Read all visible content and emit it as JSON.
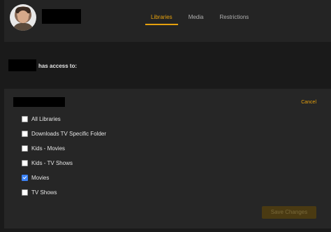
{
  "header": {
    "tabs": [
      {
        "label": "Libraries",
        "active": true
      },
      {
        "label": "Media",
        "active": false
      },
      {
        "label": "Restrictions",
        "active": false
      }
    ]
  },
  "access": {
    "text": "has access to:"
  },
  "panel": {
    "cancel_label": "Cancel",
    "save_label": "Save Changes",
    "libraries": [
      {
        "label": "All Libraries",
        "checked": false
      },
      {
        "label": "Downloads TV Specific Folder",
        "checked": false
      },
      {
        "label": "Kids - Movies",
        "checked": false
      },
      {
        "label": "Kids - TV Shows",
        "checked": false
      },
      {
        "label": "Movies",
        "checked": true
      },
      {
        "label": "TV Shows",
        "checked": false
      }
    ]
  },
  "colors": {
    "accent": "#e5a00d",
    "checkbox_checked": "#3b82f6"
  }
}
